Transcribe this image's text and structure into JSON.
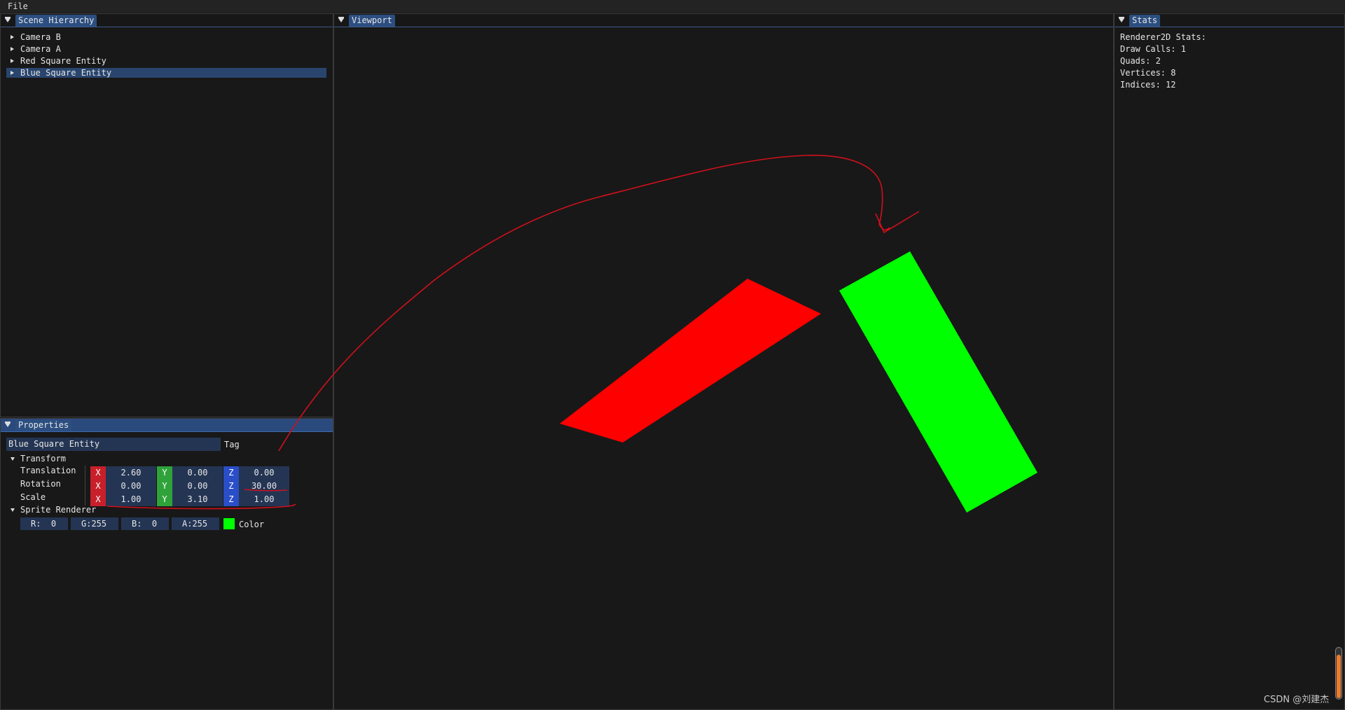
{
  "menu": {
    "file": "File"
  },
  "scene_hierarchy": {
    "title": "Scene Hierarchy",
    "items": [
      "Camera B",
      "Camera A",
      "Red Square Entity",
      "Blue Square Entity"
    ],
    "selected": "Blue Square Entity"
  },
  "properties": {
    "title": "Properties",
    "tag_value": "Blue Square Entity",
    "tag_label": "Tag",
    "transform": {
      "header": "Transform",
      "rows": [
        {
          "label": "Translation",
          "x": "2.60",
          "y": "0.00",
          "z": "0.00"
        },
        {
          "label": "Rotation",
          "x": "0.00",
          "y": "0.00",
          "z": "30.00"
        },
        {
          "label": "Scale",
          "x": "1.00",
          "y": "3.10",
          "z": "1.00"
        }
      ],
      "axis_labels": {
        "x": "X",
        "y": "Y",
        "z": "Z"
      }
    },
    "sprite_renderer": {
      "header": "Sprite Renderer",
      "r": "R:  0",
      "g": "G:255",
      "b": "B:  0",
      "a": "A:255",
      "color_label": "Color",
      "color_hex": "#00ff00"
    }
  },
  "viewport": {
    "title": "Viewport",
    "red_color": "#ff0000",
    "green_color": "#00ff00"
  },
  "stats": {
    "title": "Stats",
    "lines": [
      "Renderer2D Stats:",
      "Draw Calls: 1",
      "Quads: 2",
      "Vertices: 8",
      "Indices: 12"
    ]
  },
  "watermark": "CSDN @刘建杰"
}
